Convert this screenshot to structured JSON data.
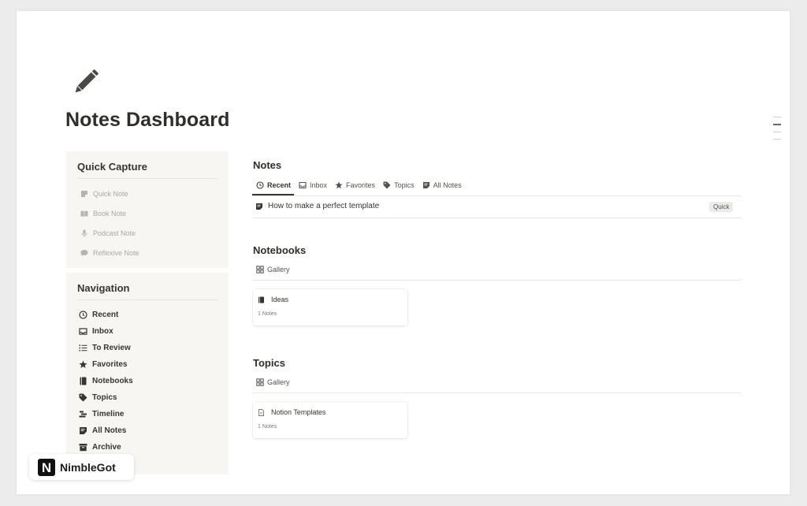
{
  "page": {
    "title": "Notes Dashboard",
    "icon": "pencil-icon"
  },
  "quick_capture": {
    "title": "Quick Capture",
    "items": [
      {
        "label": "Quick Note",
        "icon": "note-icon"
      },
      {
        "label": "Book Note",
        "icon": "book-open-icon"
      },
      {
        "label": "Podcast Note",
        "icon": "microphone-icon"
      },
      {
        "label": "Reflexive Note",
        "icon": "chat-bubble-icon"
      }
    ]
  },
  "navigation": {
    "title": "Navigation",
    "items": [
      {
        "label": "Recent",
        "icon": "clock-icon"
      },
      {
        "label": "Inbox",
        "icon": "inbox-icon"
      },
      {
        "label": "To Review",
        "icon": "list-icon"
      },
      {
        "label": "Favorites",
        "icon": "star-icon"
      },
      {
        "label": "Notebooks",
        "icon": "notebook-icon"
      },
      {
        "label": "Topics",
        "icon": "tag-icon"
      },
      {
        "label": "Timeline",
        "icon": "timeline-icon"
      },
      {
        "label": "All Notes",
        "icon": "note-icon"
      },
      {
        "label": "Archive",
        "icon": "archive-icon"
      }
    ]
  },
  "notes": {
    "title": "Notes",
    "tabs": [
      {
        "label": "Recent",
        "icon": "clock-icon",
        "active": true
      },
      {
        "label": "Inbox",
        "icon": "inbox-icon"
      },
      {
        "label": "Favorites",
        "icon": "star-icon"
      },
      {
        "label": "Topics",
        "icon": "tag-icon"
      },
      {
        "label": "All Notes",
        "icon": "note-icon"
      }
    ],
    "rows": [
      {
        "title": "How to make a perfect template",
        "tag": "Quick",
        "icon": "note-icon"
      }
    ]
  },
  "notebooks": {
    "title": "Notebooks",
    "view_label": "Gallery",
    "cards": [
      {
        "title": "Ideas",
        "count": "1 Notes",
        "icon": "notebook-icon"
      }
    ]
  },
  "topics": {
    "title": "Topics",
    "view_label": "Gallery",
    "cards": [
      {
        "title": "Notion Templates",
        "count": "1 Notes",
        "icon": "document-icon"
      }
    ]
  },
  "brand": {
    "name": "NimbleGot",
    "logo_letter": "N"
  },
  "colors": {
    "text": "#37352f",
    "muted": "#a9a8a3",
    "panel_bg": "#f7f6f3",
    "tag_bg": "#ecebe8"
  }
}
